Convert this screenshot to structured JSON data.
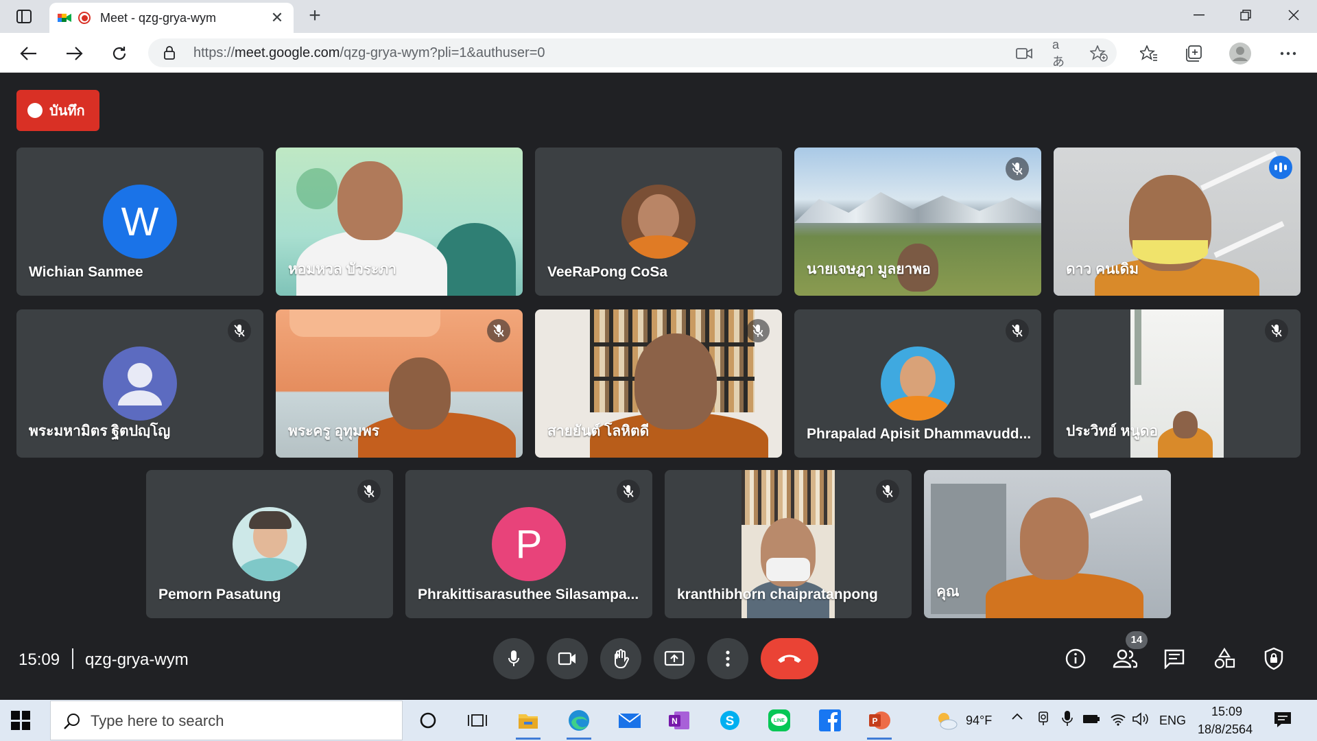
{
  "browser": {
    "tab_title": "Meet - qzg-grya-wym",
    "tab_close": "✕",
    "new_tab": "+",
    "url_prefix": "https://",
    "url_host": "meet.google.com",
    "url_path": "/qzg-grya-wym?pli=1&authuser=0",
    "read_aloud": "aあ"
  },
  "meet": {
    "recording_label": "บันทึก",
    "time": "15:09",
    "meeting_code": "qzg-grya-wym",
    "participants_count": "14",
    "tiles": [
      {
        "name": "Wichian Sanmee",
        "avatar_letter": "W",
        "avatar_color": "#1a73e8",
        "muted": false
      },
      {
        "name": "หอมหวล บัวระภา",
        "muted": false
      },
      {
        "name": "VeeRaPong CoSa",
        "muted": false
      },
      {
        "name": "นายเจษฎา มูลยาพอ",
        "muted": true
      },
      {
        "name": "ดาว คนเดิม",
        "muted": false,
        "speaking": true
      },
      {
        "name": "พระมหามิตร ฐิตปญฺโญ",
        "muted": true
      },
      {
        "name": "พระครู อุทุมพร",
        "muted": true
      },
      {
        "name": "สายยันต์ โลหิตดี",
        "muted": true
      },
      {
        "name": "Phrapalad Apisit Dhammavudd...",
        "muted": true
      },
      {
        "name": "ประวิทย์ หนูดอ",
        "muted": true
      },
      {
        "name": "Pemorn Pasatung",
        "muted": true
      },
      {
        "name": "Phrakittisarasuthee Silasampa...",
        "avatar_letter": "P",
        "avatar_color": "#e8437a",
        "muted": true
      },
      {
        "name": "kranthibhorn chaipratanpong",
        "muted": true
      },
      {
        "name": "คุณ",
        "muted": false
      }
    ]
  },
  "taskbar": {
    "search_placeholder": "Type here to search",
    "weather": "94°F",
    "language": "ENG",
    "clock_time": "15:09",
    "clock_date": "18/8/2564"
  },
  "colors": {
    "meet_bg": "#202124",
    "tile_bg": "#3c4043",
    "record_red": "#d93025",
    "end_call_red": "#ea4335",
    "speaking_blue": "#1a73e8"
  }
}
